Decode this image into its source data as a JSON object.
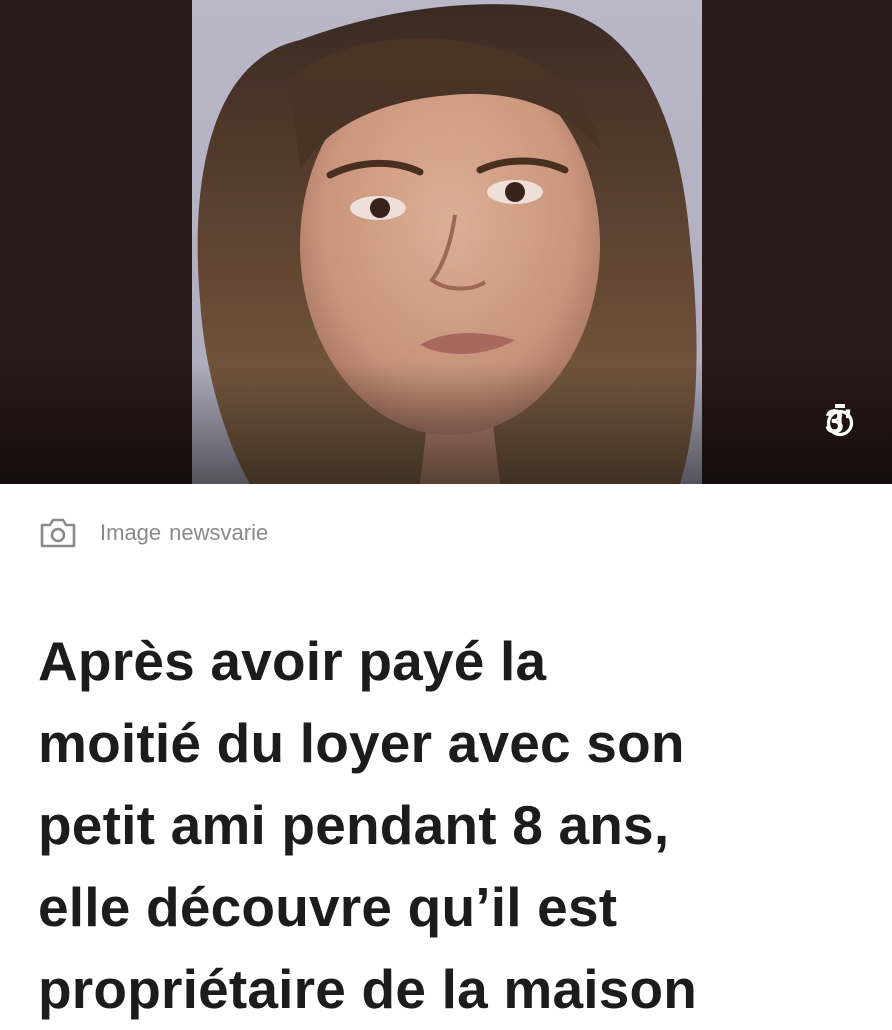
{
  "article": {
    "photo": {
      "description_icon": "portrait-photo",
      "duration": "3'",
      "duration_icon": "stopwatch-icon"
    },
    "credit": {
      "icon": "camera-icon",
      "label": "Image",
      "source": "newsvarie"
    },
    "headline_lines": [
      "Après avoir payé la",
      "moitié du loyer avec son",
      "petit ami pendant 8 ans,",
      "elle découvre qu’il est",
      "propriétaire de la maison"
    ]
  },
  "colors": {
    "background": "#ffffff",
    "headline": "#1c1c1c",
    "caption": "#8a8a8a",
    "photo_backdrop": "#2a1a18",
    "photo_wall": "#b9b7c8"
  }
}
